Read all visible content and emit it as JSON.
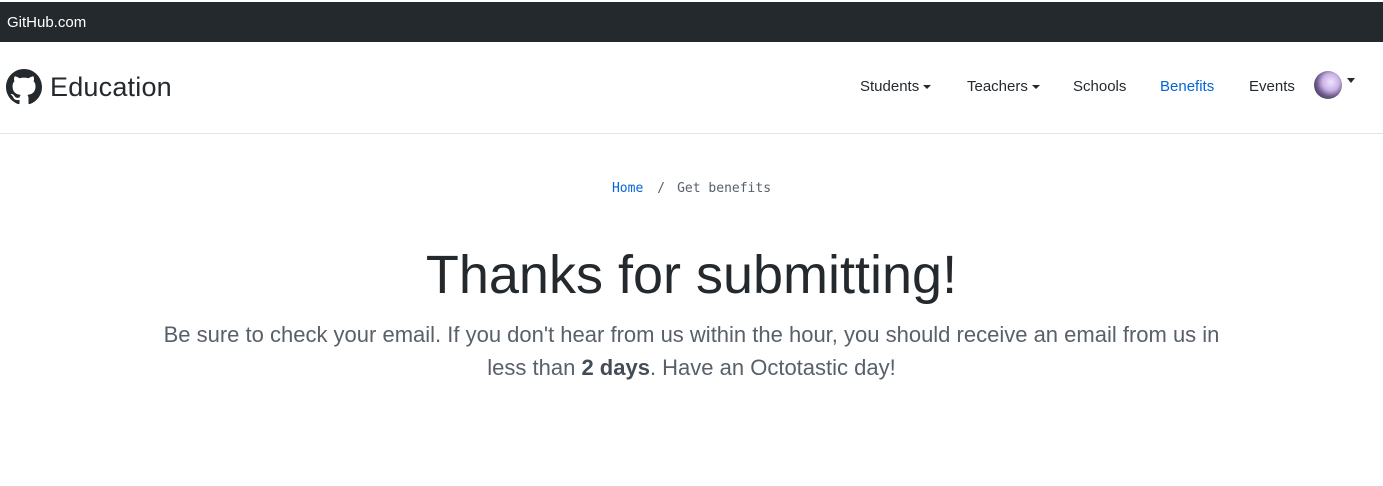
{
  "topbar": {
    "link_label": "GitHub.com"
  },
  "navbar": {
    "brand_label": "Education",
    "brand_icon": "github-octocat-icon",
    "items": [
      {
        "label": "Students",
        "dropdown": true,
        "active": false
      },
      {
        "label": "Teachers",
        "dropdown": true,
        "active": false
      },
      {
        "label": "Schools",
        "dropdown": false,
        "active": false
      },
      {
        "label": "Benefits",
        "dropdown": false,
        "active": true
      },
      {
        "label": "Events",
        "dropdown": false,
        "active": false
      }
    ],
    "active_color": "#0366d6"
  },
  "breadcrumb": {
    "home_label": "Home",
    "separator": "/",
    "current_label": "Get benefits"
  },
  "main": {
    "heading": "Thanks for submitting!",
    "lead_part1": "Be sure to check your email. If you don't hear from us within the hour, you should receive an email from us in less than ",
    "lead_bold": "2 days",
    "lead_part2": ". Have an Octotastic day!"
  },
  "colors": {
    "topbar_bg": "#24292e",
    "link": "#0366d6",
    "text": "#24292e",
    "muted": "#586069"
  }
}
